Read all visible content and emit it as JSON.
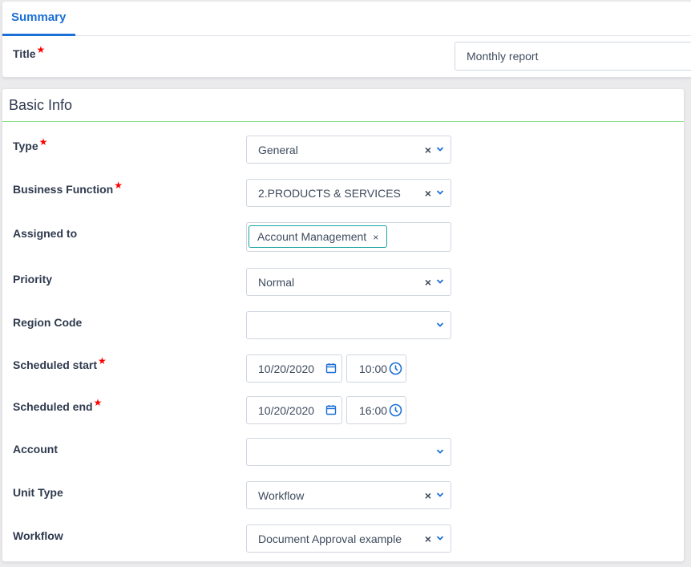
{
  "tabs": [
    {
      "label": "Summary",
      "active": true
    }
  ],
  "title_field": {
    "label": "Title",
    "required": true,
    "value": "Monthly report"
  },
  "section": {
    "title": "Basic Info"
  },
  "colors": {
    "accent": "#1b6fd6",
    "required": "#ff0000",
    "section_rule": "#8ee08e",
    "tag_border": "#1aa3a3"
  },
  "fields": {
    "type": {
      "label": "Type",
      "required": true,
      "value": "General",
      "clearable": true
    },
    "business_function": {
      "label": "Business Function",
      "required": true,
      "value": "2.PRODUCTS & SERVICES",
      "clearable": true
    },
    "assigned_to": {
      "label": "Assigned to",
      "required": false,
      "tags": [
        "Account Management"
      ],
      "tag_remove": "×"
    },
    "priority": {
      "label": "Priority",
      "required": false,
      "value": "Normal",
      "clearable": true
    },
    "region_code": {
      "label": "Region Code",
      "required": false,
      "value": ""
    },
    "scheduled_start": {
      "label": "Scheduled start",
      "required": true,
      "date": "10/20/2020",
      "time": "10:00"
    },
    "scheduled_end": {
      "label": "Scheduled end",
      "required": true,
      "date": "10/20/2020",
      "time": "16:00"
    },
    "account": {
      "label": "Account",
      "required": false,
      "value": ""
    },
    "unit_type": {
      "label": "Unit Type",
      "required": false,
      "value": "Workflow",
      "clearable": true
    },
    "workflow": {
      "label": "Workflow",
      "required": false,
      "value": "Document Approval example",
      "clearable": true
    }
  },
  "glyphs": {
    "required_star": "★",
    "clear": "×"
  }
}
